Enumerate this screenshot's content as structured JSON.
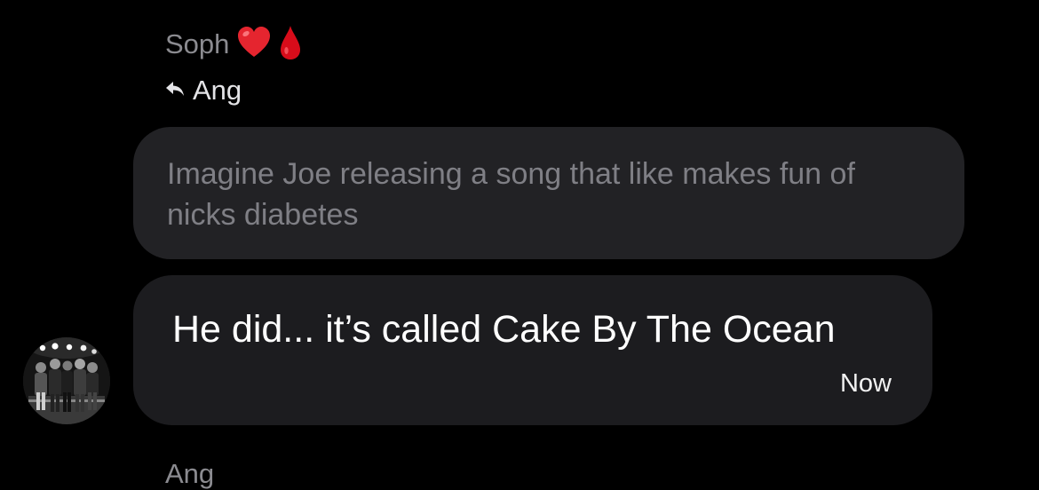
{
  "thread": {
    "sender_name": "Soph",
    "sender_emoji": [
      "heart-emoji",
      "blood-drop-emoji"
    ],
    "reply_to_name": "Ang",
    "reply_icon": "reply-arrow-icon",
    "quoted_message": "Imagine Joe releasing a song that like makes fun of nicks diabetes",
    "message": {
      "text": "He did... it’s called Cake By The Ocean",
      "timestamp": "Now"
    },
    "next_sender_name": "Ang"
  },
  "colors": {
    "background": "#000000",
    "quoted_bubble": "#222225",
    "message_bubble": "#1c1c1f",
    "muted_text": "#8b8b90",
    "quoted_text": "#7f7f85",
    "heart": "#e5252f",
    "blood_drop": "#d80c1a"
  }
}
